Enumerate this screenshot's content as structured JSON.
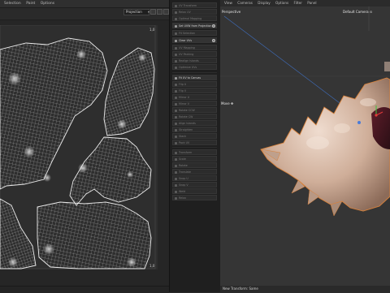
{
  "uv_editor": {
    "menu": [
      "Selection",
      "Paint",
      "Options"
    ],
    "projection_mode": "Projection",
    "corner_top_right": "1,0",
    "corner_bottom_right": "1,0"
  },
  "tools": {
    "group1": [
      "UV Transform",
      "Relax UV",
      "Optimal Mapping",
      "Fit UV to Canvas"
    ],
    "set_uvw_label": "Set UVW from Projection",
    "group2": [
      "Fit Selection",
      "Clear UVs",
      "UV Mapping",
      "UV Packing",
      "Realign Islands",
      "Optimize UVs"
    ],
    "fit_uv_label": "Fit UV to Canvas",
    "group3": [
      "Flip U",
      "Flip V",
      "Mirror U",
      "Mirror V",
      "Rotate CCW",
      "Rotate CW",
      "Align Islands",
      "Straighten",
      "Stack",
      "Pack UV"
    ],
    "group4": [
      "Transform",
      "Scale",
      "Rotate",
      "Translate",
      "Snap U",
      "Snap V",
      "Weld",
      "Relax",
      "Unwrap",
      "Cut Seam",
      "Stitch",
      "Reset",
      "Apply"
    ]
  },
  "viewport": {
    "menu": [
      "View",
      "Cameras",
      "Display",
      "Options",
      "Filter",
      "Panel"
    ],
    "view_label": "Perspective",
    "camera_label": "Default Camera",
    "tool_label": "Move",
    "status": "New Transform: Same"
  },
  "colors": {
    "accent_orange": "#d9823b",
    "uv_wire": "#d8d8d8",
    "shell": "#cfae99"
  }
}
